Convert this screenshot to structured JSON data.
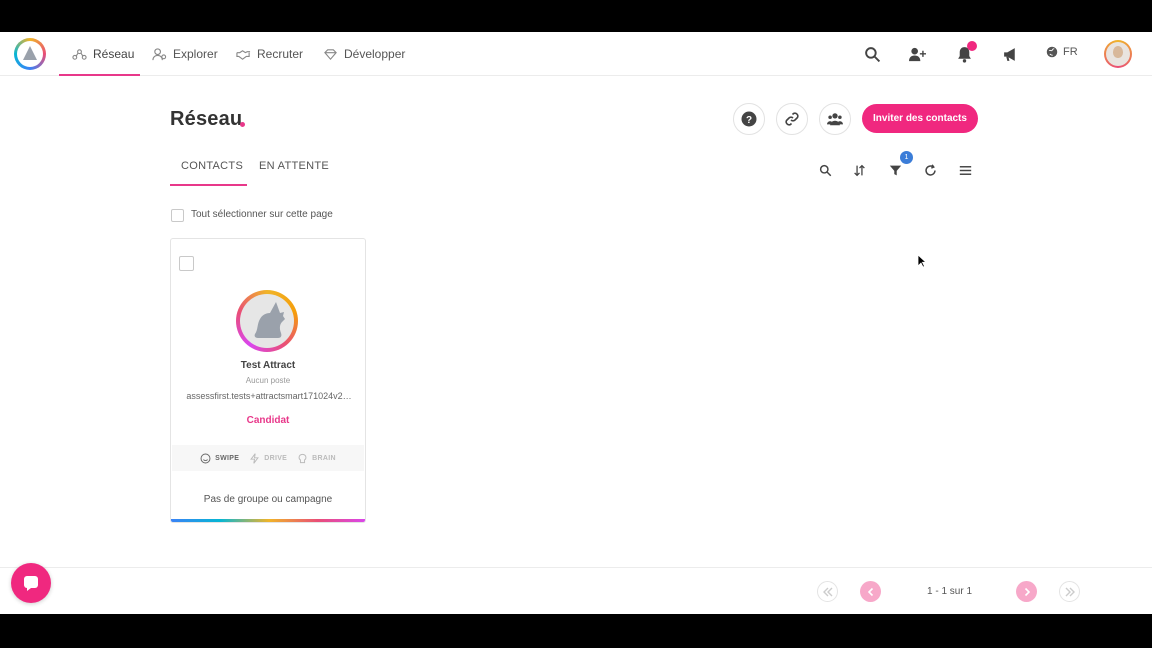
{
  "nav": {
    "items": [
      {
        "label": "Réseau",
        "icon": "network-icon"
      },
      {
        "label": "Explorer",
        "icon": "users-search-icon"
      },
      {
        "label": "Recruter",
        "icon": "handshake-icon"
      },
      {
        "label": "Développer",
        "icon": "diamond-icon"
      }
    ],
    "language": "FR"
  },
  "page": {
    "title": "Réseau",
    "invite_label": "Inviter des contacts"
  },
  "tabs": [
    {
      "label": "CONTACTS",
      "active": true
    },
    {
      "label": "EN ATTENTE",
      "active": false
    }
  ],
  "toolbar": {
    "filter_count": "1"
  },
  "select_all_label": "Tout sélectionner sur cette page",
  "card": {
    "name": "Test Attract",
    "position": "Aucun poste",
    "email": "assessfirst.tests+attractsmart171024v2…",
    "role": "Candidat",
    "tools": [
      "SWIPE",
      "DRIVE",
      "BRAIN"
    ],
    "footer": "Pas de groupe ou campagne"
  },
  "pagination": {
    "info": "1 - 1 sur 1"
  },
  "colors": {
    "accent": "#e8388a",
    "button": "#f0287f",
    "badge": "#3b7dd8"
  }
}
